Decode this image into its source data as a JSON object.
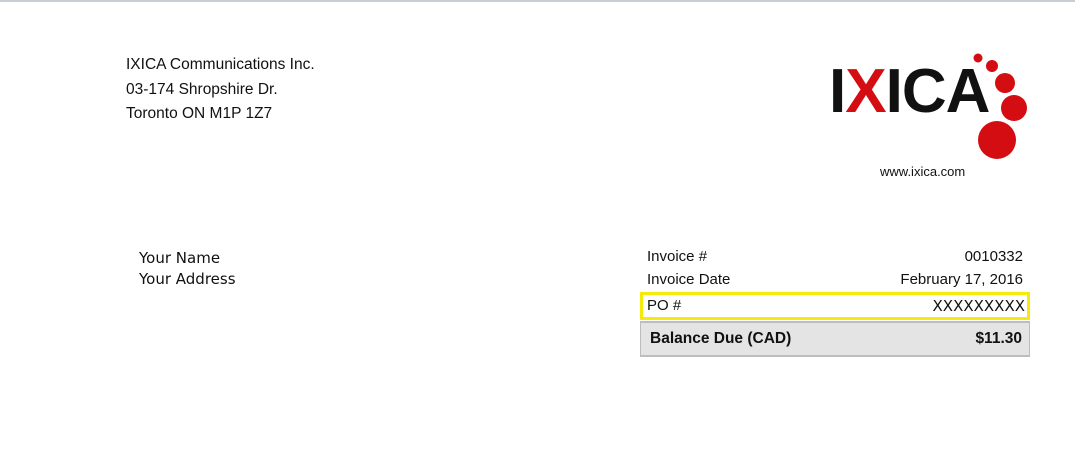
{
  "company": {
    "name": "IXICA Communications Inc.",
    "address_line1": "03-174 Shropshire Dr.",
    "address_line2": "Toronto ON  M1P 1Z7"
  },
  "logo": {
    "text_before": "I",
    "text_accent": "X",
    "text_after": "ICA",
    "accent_color": "#d40d12",
    "text_color": "#111111"
  },
  "website": "www.ixica.com",
  "recipient": {
    "name": "Your Name",
    "address": "Your Address"
  },
  "invoice": {
    "number_label": "Invoice #",
    "number_value": "0010332",
    "date_label": "Invoice Date",
    "date_value": "February 17, 2016",
    "po_label": "PO #",
    "po_value": "XXXXXXXXX",
    "balance_label": "Balance Due (CAD)",
    "balance_value": "$11.30"
  },
  "colors": {
    "highlight": "#f5ea0c",
    "balance_background": "#e4e4e4"
  }
}
